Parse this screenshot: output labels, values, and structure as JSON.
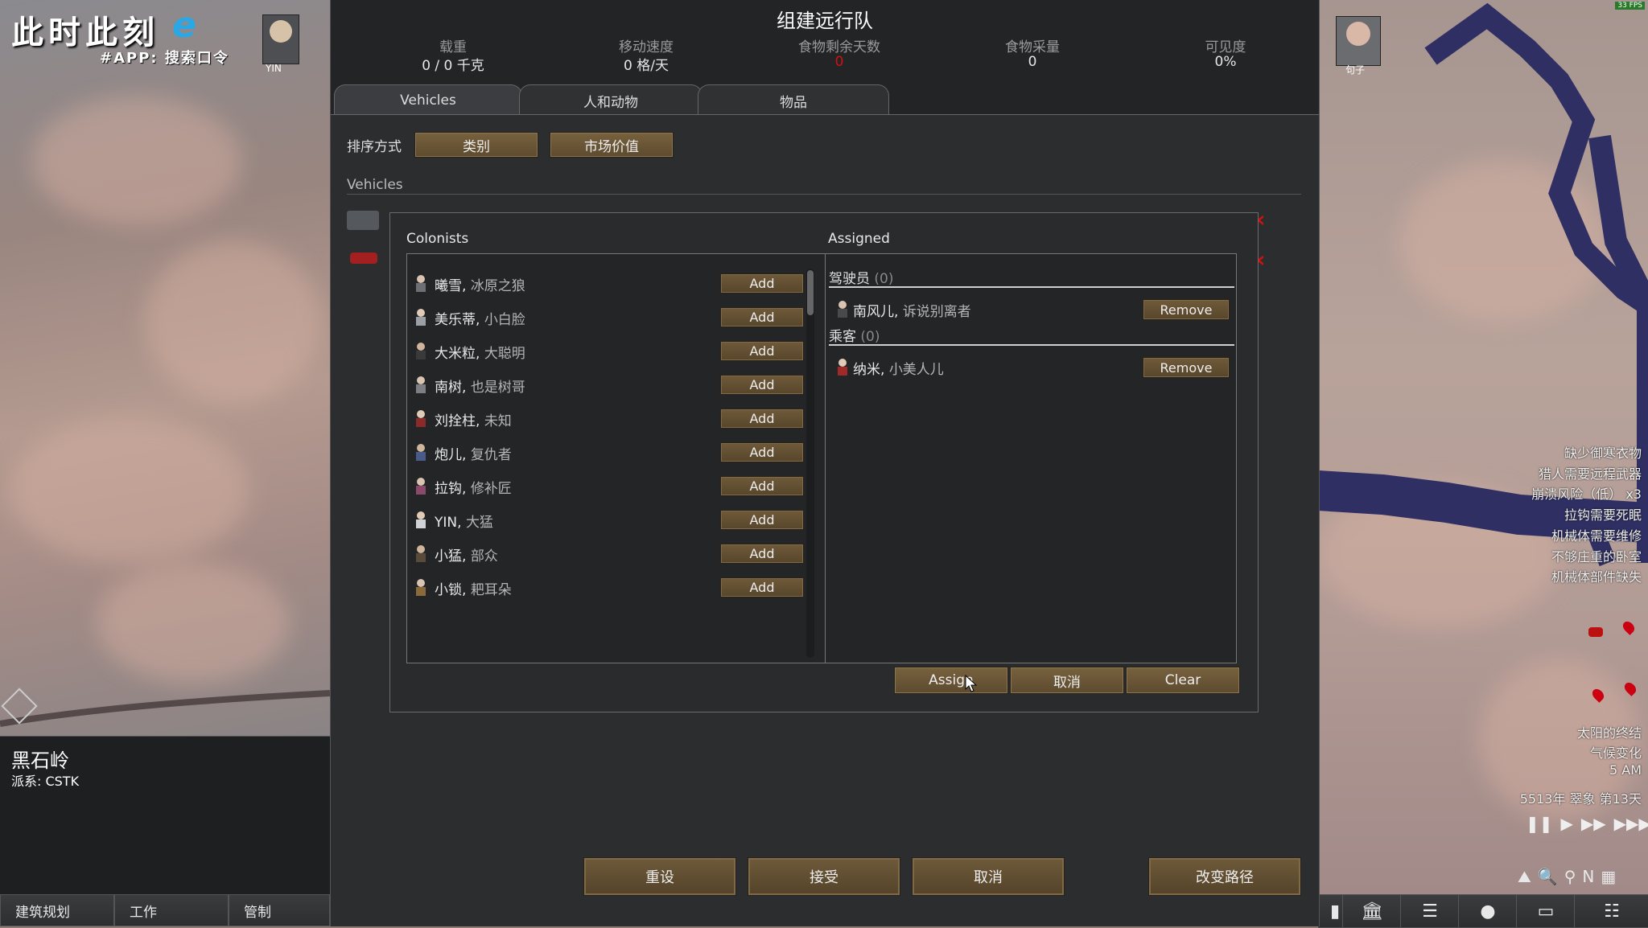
{
  "dialog": {
    "title": "组建远行队",
    "stats": [
      {
        "label": "载重",
        "value": "0 / 0 千克"
      },
      {
        "label": "移动速度",
        "value": "0 格/天"
      },
      {
        "label": "食物剩余天数",
        "value": "0"
      },
      {
        "label": "食物采量",
        "value": "0"
      },
      {
        "label": "可见度",
        "value": "0%"
      }
    ],
    "tabs": [
      "Vehicles",
      "人和动物",
      "物品"
    ],
    "sort_label": "排序方式",
    "sort_buttons": [
      "类别",
      "市场价值"
    ],
    "section_label": "Vehicles",
    "bottom_buttons": {
      "reset": "重设",
      "accept": "接受",
      "cancel": "取消",
      "change_route": "改变路径"
    }
  },
  "assign_popup": {
    "colonists_header": "Colonists",
    "assigned_header": "Assigned",
    "colonists": [
      {
        "name": "曦雪",
        "title": "冰原之狼",
        "action": "Add"
      },
      {
        "name": "美乐蒂",
        "title": "小白脸",
        "action": "Add"
      },
      {
        "name": "大米粒",
        "title": "大聪明",
        "action": "Add"
      },
      {
        "name": "南树",
        "title": "也是树哥",
        "action": "Add"
      },
      {
        "name": "刘拴柱",
        "title": "未知",
        "action": "Add"
      },
      {
        "name": "炮儿",
        "title": "复仇者",
        "action": "Add"
      },
      {
        "name": "拉钩",
        "title": "修补匠",
        "action": "Add"
      },
      {
        "name": "YIN",
        "title": "大猛",
        "action": "Add"
      },
      {
        "name": "小猛",
        "title": "部众",
        "action": "Add"
      },
      {
        "name": "小锁",
        "title": "耙耳朵",
        "action": "Add"
      }
    ],
    "roles": [
      {
        "label": "驾驶员",
        "count": "(0)",
        "members": [
          {
            "name": "南风儿",
            "title": "诉说别离者",
            "action": "Remove"
          }
        ]
      },
      {
        "label": "乘客",
        "count": "(0)",
        "members": [
          {
            "name": "纳米",
            "title": "小美人儿",
            "action": "Remove"
          }
        ]
      }
    ],
    "buttons": {
      "assign": "Assign",
      "cancel": "取消",
      "clear": "Clear"
    }
  },
  "overlay": {
    "stream_title": "此时此刻",
    "stream_app": "#APP: 搜索口令",
    "colonist_portrait_left": "YIN",
    "colonist_portrait_right": "句子",
    "fps": "33 FPS"
  },
  "location": {
    "name": "黑石岭",
    "faction": "派系: CSTK"
  },
  "alerts": [
    "缺少御寒衣物",
    "猎人需要远程武器",
    "崩溃风险（低） x3",
    "拉钩需要死眠",
    "机械体需要维修",
    "不够庄重的卧室",
    "机械体部件缺失"
  ],
  "time": {
    "event1": "太阳的终结",
    "event2": "气候变化",
    "clock": "5 AM",
    "date": "5513年 翠象 第13天"
  },
  "main_tabs": [
    "建筑规划",
    "工作",
    "管制"
  ],
  "colors": {
    "gold_button": "#6f5a39",
    "dialog_bg": "#222426",
    "river": "#2f2f63",
    "alert_red": "#d11111"
  }
}
